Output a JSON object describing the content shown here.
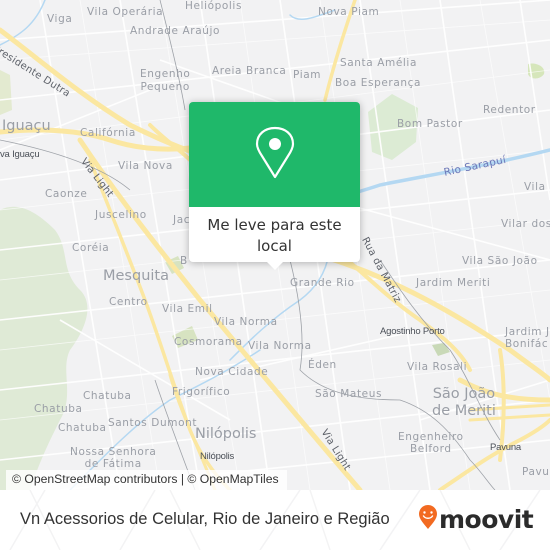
{
  "map": {
    "colors": {
      "background": "#f2f2f3",
      "major_road": "#fbe9a4",
      "minor_road": "#ffffff",
      "water": "#a9d3f0",
      "park": "#d8ead0",
      "forest": "#dbe9cf"
    },
    "labels": {
      "viga": "Viga",
      "vila_operaria": "Vila Operária",
      "heliopolis": "Heliópolis",
      "nova_piam": "Nova Piam",
      "andrade_araujo": "Andrade Araújo",
      "presidente_dutra": "Presidente Dutra",
      "engenho_pequeno": "Engenho\nPequeno",
      "areia_branca": "Areia Branca",
      "piam": "Piam",
      "santa_amelia": "Santa Amélia",
      "boa_esperanca": "Boa Esperança",
      "redentor": "Redentor",
      "bom_pastor": "Bom Pastor",
      "nova_iguacu_city": "Iguaçu",
      "california": "Califórnia",
      "nova_iguacu_station": "va Iguaçu",
      "via_light_1": "Via Light",
      "vila_nova": "Vila Nova",
      "rio_sarapui": "Rio Sarapuí",
      "caonze": "Caonze",
      "juscelino": "Juscelino",
      "jac": "Jac",
      "vila_s": "Vila S",
      "vilar_dos": "Vilar dos",
      "rua_da_matriz": "Rua da Matriz",
      "coreia": "Coréia",
      "vila_sao_joao": "Vila São João",
      "b": "B",
      "mesquita": "Mesquita",
      "grande_rio": "Grande Rio",
      "jardim_meriti": "Jardim Meriti",
      "centro": "Centro",
      "vila_emil": "Vila Emil",
      "vila_norma_1": "Vila Norma",
      "agostinho_porto": "Agostinho Porto",
      "jardim_bonifacio": "Jardim Jo\nBonifác",
      "cosmorama": "Cosmorama",
      "vila_norma_2": "Vila Norma",
      "eden": "Éden",
      "vila_rosali": "Vila Rosali",
      "nova_cidade": "Nova Cidade",
      "sao_mateus": "São Mateus",
      "sao_joao_de_meriti": "São João\nde Meriti",
      "frigorifico": "Frigorífico",
      "chatuba_1": "Chatuba",
      "chatuba_2": "Chatuba",
      "chatuba_3": "Chatuba",
      "santos_dumont": "Santos Dumont",
      "nilopolis": "Nilópolis",
      "engenheiro_belford": "Engenheiro\nBelford",
      "nossa_senhora_de_fatima": "Nossa Senhora\nde Fátima",
      "nilopolis_station": "Nilópolis",
      "via_light_2": "Via Light",
      "pavuna": "Pavuna",
      "pavu": "Pavu"
    }
  },
  "popup": {
    "icon": "map-pin-icon",
    "accent_color": "#1fb86a",
    "label": "Me leve para este local"
  },
  "attribution": {
    "text": "© OpenStreetMap contributors | © OpenMapTiles"
  },
  "footer": {
    "title": "Vn Acessorios de Celular, Rio de Janeiro e Região",
    "brand": {
      "icon": "moovit-pin-smiley-icon",
      "name": "moovit",
      "color": "#f26a21"
    }
  }
}
